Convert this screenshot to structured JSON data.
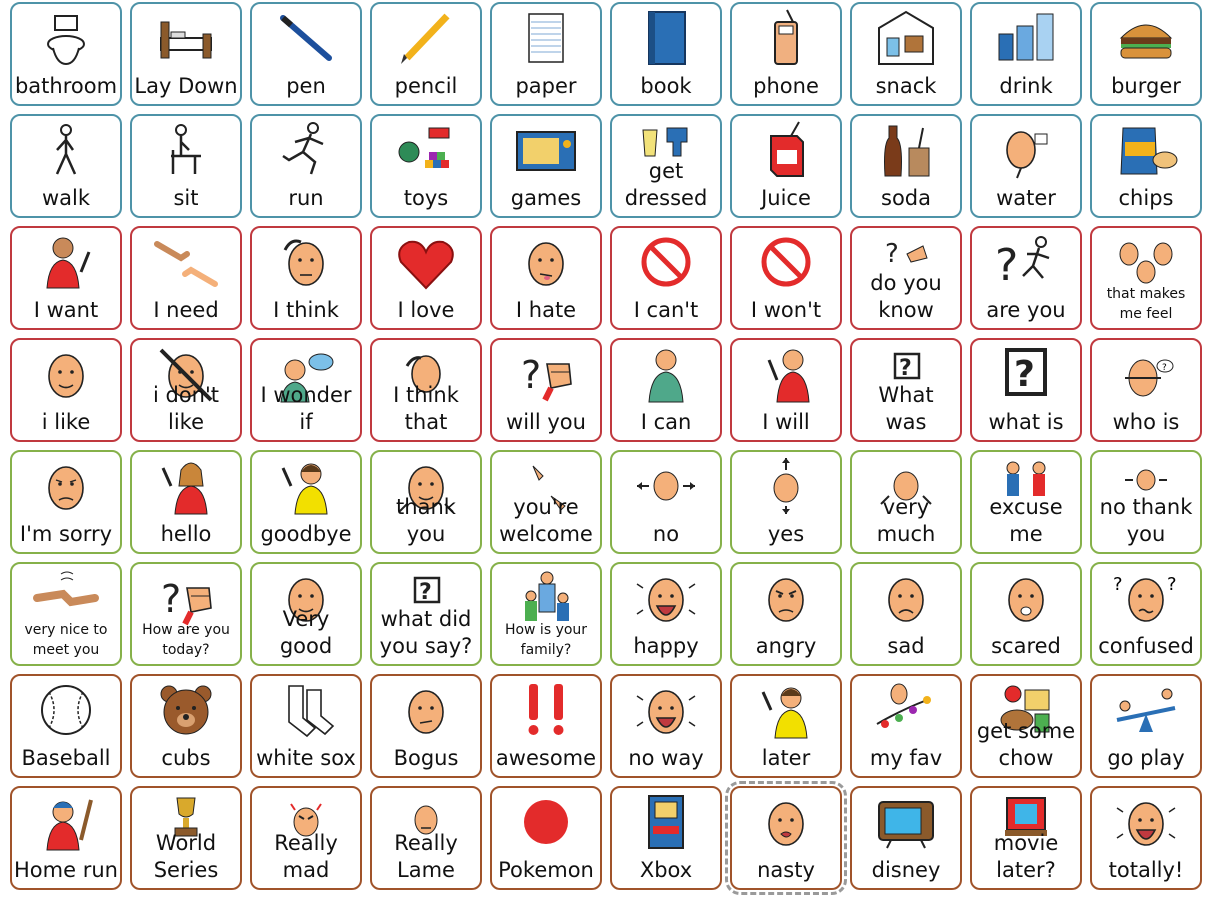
{
  "board": {
    "rows": [
      {
        "color": "teal",
        "cells": [
          {
            "label": "bathroom",
            "icon": "toilet-icon"
          },
          {
            "label": "Lay Down",
            "icon": "bed-icon"
          },
          {
            "label": "pen",
            "icon": "pen-icon"
          },
          {
            "label": "pencil",
            "icon": "pencil-icon"
          },
          {
            "label": "paper",
            "icon": "paper-icon"
          },
          {
            "label": "book",
            "icon": "book-icon"
          },
          {
            "label": "phone",
            "icon": "phone-icon"
          },
          {
            "label": "snack",
            "icon": "snack-icon"
          },
          {
            "label": "drink",
            "icon": "cups-icon"
          },
          {
            "label": "burger",
            "icon": "burger-icon"
          }
        ]
      },
      {
        "color": "teal",
        "cells": [
          {
            "label": "walk",
            "icon": "walking-person-icon"
          },
          {
            "label": "sit",
            "icon": "sitting-person-icon"
          },
          {
            "label": "run",
            "icon": "running-person-icon"
          },
          {
            "label": "toys",
            "icon": "toys-icon"
          },
          {
            "label": "games",
            "icon": "game-board-icon"
          },
          {
            "label": "get\ndressed",
            "icon": "clothes-icon"
          },
          {
            "label": "Juice",
            "icon": "juice-box-icon"
          },
          {
            "label": "soda",
            "icon": "soda-bottle-icon"
          },
          {
            "label": "water",
            "icon": "person-drinking-icon"
          },
          {
            "label": "chips",
            "icon": "chips-bag-icon"
          }
        ]
      },
      {
        "color": "red",
        "cells": [
          {
            "label": "I want",
            "icon": "person-wanting-icon"
          },
          {
            "label": "I need",
            "icon": "hands-reaching-icon"
          },
          {
            "label": "I think",
            "icon": "thinking-face-icon"
          },
          {
            "label": "I love",
            "icon": "heart-icon"
          },
          {
            "label": "I hate",
            "icon": "disgusted-face-icon"
          },
          {
            "label": "I can't",
            "icon": "prohibited-icon"
          },
          {
            "label": "I won't",
            "icon": "prohibited-icon"
          },
          {
            "label": "do you\nknow",
            "icon": "question-hand-icon"
          },
          {
            "label": "are you",
            "icon": "question-runner-icon"
          },
          {
            "label": "that makes\nme feel",
            "icon": "feeling-faces-icon",
            "small": true
          }
        ]
      },
      {
        "color": "red",
        "cells": [
          {
            "label": "i like",
            "icon": "smiling-face-icon"
          },
          {
            "label": "i don't like",
            "icon": "crossed-face-icon"
          },
          {
            "label": "I wonder\nif",
            "icon": "wondering-person-icon"
          },
          {
            "label": "I think\nthat",
            "icon": "thinking-head-icon"
          },
          {
            "label": "will you",
            "icon": "question-fist-icon"
          },
          {
            "label": "I can",
            "icon": "person-can-icon"
          },
          {
            "label": "I will",
            "icon": "person-will-icon"
          },
          {
            "label": "What\nwas",
            "icon": "question-box-icon"
          },
          {
            "label": "what is",
            "icon": "question-box-large-icon"
          },
          {
            "label": "who is",
            "icon": "who-face-icon"
          }
        ]
      },
      {
        "color": "green",
        "cells": [
          {
            "label": "I'm sorry",
            "icon": "sorry-face-icon"
          },
          {
            "label": "hello",
            "icon": "waving-girl-icon"
          },
          {
            "label": "goodbye",
            "icon": "waving-boy-icon"
          },
          {
            "label": "thank you",
            "icon": "thank-you-face-icon"
          },
          {
            "label": "you're\nwelcome",
            "icon": "signing-hands-icon"
          },
          {
            "label": "no",
            "icon": "head-shake-icon"
          },
          {
            "label": "yes",
            "icon": "head-nod-icon"
          },
          {
            "label": "very\nmuch",
            "icon": "very-much-face-icon"
          },
          {
            "label": "excuse\nme",
            "icon": "two-people-icon"
          },
          {
            "label": "no thank\nyou",
            "icon": "head-shake-small-icon"
          }
        ]
      },
      {
        "color": "green",
        "cells": [
          {
            "label": "very nice to\nmeet you",
            "icon": "handshake-icon",
            "small": true
          },
          {
            "label": "How are you\ntoday?",
            "icon": "question-fist-icon",
            "small": true
          },
          {
            "label": "Very good",
            "icon": "happy-face-icon"
          },
          {
            "label": "what did\nyou say?",
            "icon": "question-box-icon"
          },
          {
            "label": "How is your\nfamily?",
            "icon": "family-icon",
            "small": true
          },
          {
            "label": "happy",
            "icon": "laughing-face-icon"
          },
          {
            "label": "angry",
            "icon": "angry-face-icon"
          },
          {
            "label": "sad",
            "icon": "sad-face-icon"
          },
          {
            "label": "scared",
            "icon": "scared-face-icon"
          },
          {
            "label": "confused",
            "icon": "confused-face-icon"
          }
        ]
      },
      {
        "color": "brown",
        "cells": [
          {
            "label": "Baseball",
            "icon": "baseball-icon"
          },
          {
            "label": "cubs",
            "icon": "bear-icon"
          },
          {
            "label": "white sox",
            "icon": "socks-icon"
          },
          {
            "label": "Bogus",
            "icon": "bogus-face-icon"
          },
          {
            "label": "awesome",
            "icon": "exclamation-icon"
          },
          {
            "label": "no way",
            "icon": "laughing-face-icon"
          },
          {
            "label": "later",
            "icon": "waving-boy-icon"
          },
          {
            "label": "my fav",
            "icon": "favorite-icon"
          },
          {
            "label": "get some\nchow",
            "icon": "food-icon"
          },
          {
            "label": "go play",
            "icon": "seesaw-icon"
          }
        ]
      },
      {
        "color": "brown",
        "cells": [
          {
            "label": "Home run",
            "icon": "baseball-player-icon"
          },
          {
            "label": "World\nSeries",
            "icon": "trophy-icon"
          },
          {
            "label": "Really\nmad",
            "icon": "mad-face-icon"
          },
          {
            "label": "Really\nLame",
            "icon": "lame-face-icon"
          },
          {
            "label": "Pokemon",
            "icon": "red-circle-icon"
          },
          {
            "label": "Xbox",
            "icon": "arcade-icon"
          },
          {
            "label": "nasty",
            "icon": "nasty-face-icon",
            "selected": true
          },
          {
            "label": "disney",
            "icon": "television-icon"
          },
          {
            "label": "movie\nlater?",
            "icon": "theater-icon"
          },
          {
            "label": "totally!",
            "icon": "laughing-face-icon"
          }
        ]
      }
    ]
  },
  "colors": {
    "teal": "#4e93a8",
    "red": "#c0393f",
    "green": "#86b14a",
    "brown": "#a0532a",
    "skin": "#f4b07a",
    "red_fill": "#e32b2b",
    "blue_fill": "#2a6fb5"
  }
}
